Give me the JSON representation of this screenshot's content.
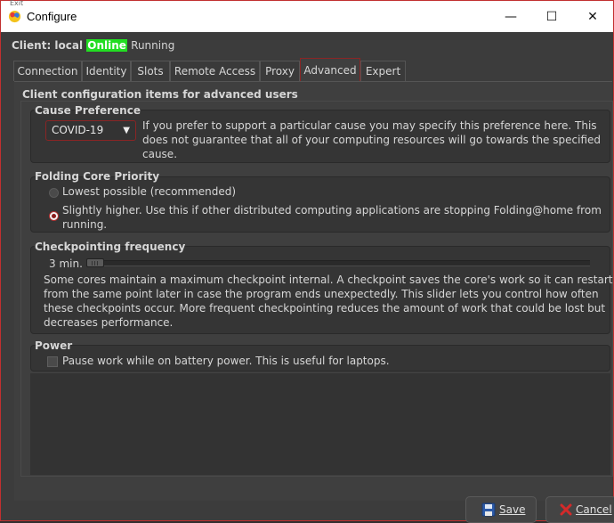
{
  "window": {
    "title": "Configure",
    "ghost_text": "Exit",
    "minimize_glyph": "—",
    "maximize_glyph": "☐",
    "close_glyph": "✕"
  },
  "client": {
    "label": "Client: local",
    "status": "Online",
    "state": "Running",
    "status_color": "#22dd22"
  },
  "tabs": [
    "Connection",
    "Identity",
    "Slots",
    "Remote Access",
    "Proxy",
    "Advanced",
    "Expert"
  ],
  "active_tab": "Advanced",
  "advanced": {
    "heading": "Client configuration items for advanced users",
    "cause": {
      "title": "Cause Preference",
      "selected": "COVID-19",
      "description_lines": [
        "If you prefer to support a particular cause you may specify this preference here.  This",
        "does not guarantee that all of your computing resources will go towards the specified",
        "cause."
      ]
    },
    "priority": {
      "title": "Folding Core Priority",
      "options": [
        {
          "lines": [
            "Lowest possible (recommended)"
          ],
          "selected": false
        },
        {
          "lines": [
            "Slightly higher.  Use this if other distributed computing applications are stopping Folding@home from",
            "running."
          ],
          "selected": true
        }
      ]
    },
    "checkpoint": {
      "title": "Checkpointing frequency",
      "value_label": "3 min.",
      "slider_fraction": 0.0,
      "description_lines": [
        "Some cores maintain a maximum checkpoint internal.  A checkpoint saves the core's work so it can restart",
        "from the same point later in case the program ends unexpectedly.  This slider lets you control how often",
        "these checkpoints occur.  More frequent checkpointing reduces the amount of work that could be lost but",
        "decreases performance."
      ]
    },
    "power": {
      "title": "Power",
      "checkbox_label": "Pause work while on battery power.  This is useful for laptops.",
      "checked": false
    }
  },
  "buttons": {
    "save": "Save",
    "cancel": "Cancel"
  },
  "colors": {
    "accent": "#8a2525",
    "frame": "#c23030"
  },
  "icons": {
    "app": "fah-icon",
    "save": "floppy-disk-icon",
    "cancel": "red-x-icon"
  }
}
